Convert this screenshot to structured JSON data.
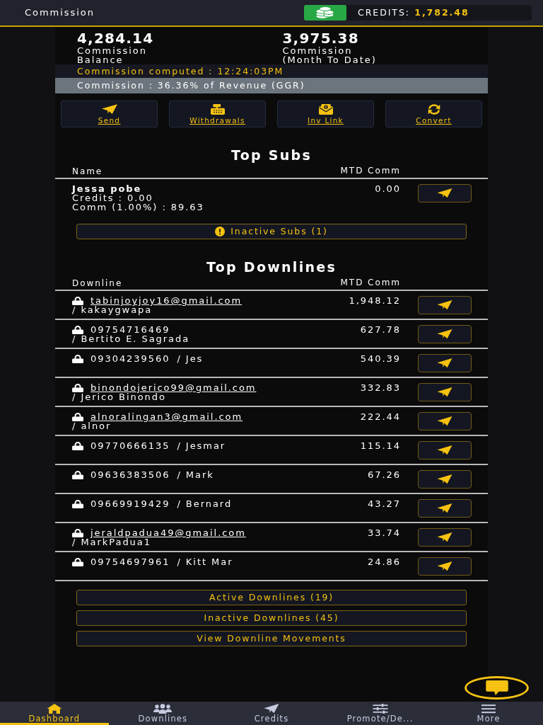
{
  "header": {
    "title": "Commission",
    "credits_label": "CREDITS:",
    "credits_value": "1,782.48"
  },
  "stats": [
    {
      "value": "4,284.14",
      "label": "Commission Balance"
    },
    {
      "value": "3,975.38",
      "label": "Commission (Month To Date)"
    }
  ],
  "notices": [
    {
      "kind": "time",
      "text": "Commission computed : 12:24:03PM"
    },
    {
      "kind": "rate",
      "text": "Commission : 36.36% of Revenue (GGR)"
    }
  ],
  "actions": [
    {
      "kind": "send",
      "label": "Send"
    },
    {
      "kind": "withdraw",
      "label": "Withdrawals"
    },
    {
      "kind": "invite",
      "label": "Inv Link"
    },
    {
      "kind": "convert",
      "label": "Convert"
    }
  ],
  "top_subs": {
    "title": "Top Subs",
    "columns": [
      "Name",
      "MTD Comm"
    ],
    "rows": [
      {
        "name": "Jessa pobe",
        "credits": "Credits : 0.00",
        "comm": "Comm (1.00%) : 89.63",
        "mtd_comm": "0.00"
      }
    ],
    "inactive_button": "Inactive Subs (1)"
  },
  "top_downlines": {
    "title": "Top Downlines",
    "columns": [
      "Downline",
      "MTD Comm"
    ],
    "rows": [
      {
        "account": "tabinjoyjoy16@gmail.com",
        "linked": true,
        "separator": "/",
        "name": "kakaygwapa",
        "mtd_comm": "1,948.12"
      },
      {
        "account": "09754716469",
        "linked": false,
        "separator": "/",
        "name": "Bertito E. Sagrada",
        "mtd_comm": "627.78"
      },
      {
        "account": "09304239560",
        "linked": false,
        "separator": "/",
        "name": "Jes",
        "mtd_comm": "540.39"
      },
      {
        "account": "binondojerico99@gmail.com",
        "linked": true,
        "separator": "/",
        "name": "Jerico Binondo",
        "mtd_comm": "332.83"
      },
      {
        "account": "alnoralingan3@gmail.com",
        "linked": true,
        "separator": "/",
        "name": "alnor",
        "mtd_comm": "222.44"
      },
      {
        "account": "09770666135",
        "linked": false,
        "separator": "/",
        "name": "Jesmar",
        "mtd_comm": "115.14"
      },
      {
        "account": "09636383506",
        "linked": false,
        "separator": "/",
        "name": "Mark",
        "mtd_comm": "67.26"
      },
      {
        "account": "09669919429",
        "linked": false,
        "separator": "/",
        "name": "Bernard",
        "mtd_comm": "43.27"
      },
      {
        "account": "jeraldpadua49@gmail.com",
        "linked": true,
        "separator": "/",
        "name": "MarkPadua1",
        "mtd_comm": "33.74"
      },
      {
        "account": "09754697961",
        "linked": false,
        "separator": "/",
        "name": "Kitt Mar",
        "mtd_comm": "24.86"
      }
    ]
  },
  "buttons": [
    "Active Downlines (19)",
    "Inactive Downlines (45)",
    "View Downline Movements"
  ],
  "bottom_nav": [
    {
      "kind": "home",
      "label": "Dashboard",
      "selected": true
    },
    {
      "kind": "users",
      "label": "Downlines",
      "selected": false
    },
    {
      "kind": "send",
      "label": "Credits",
      "selected": false
    },
    {
      "kind": "sliders",
      "label": "Promote/De...",
      "selected": false
    },
    {
      "kind": "menu",
      "label": "More",
      "selected": false
    }
  ]
}
